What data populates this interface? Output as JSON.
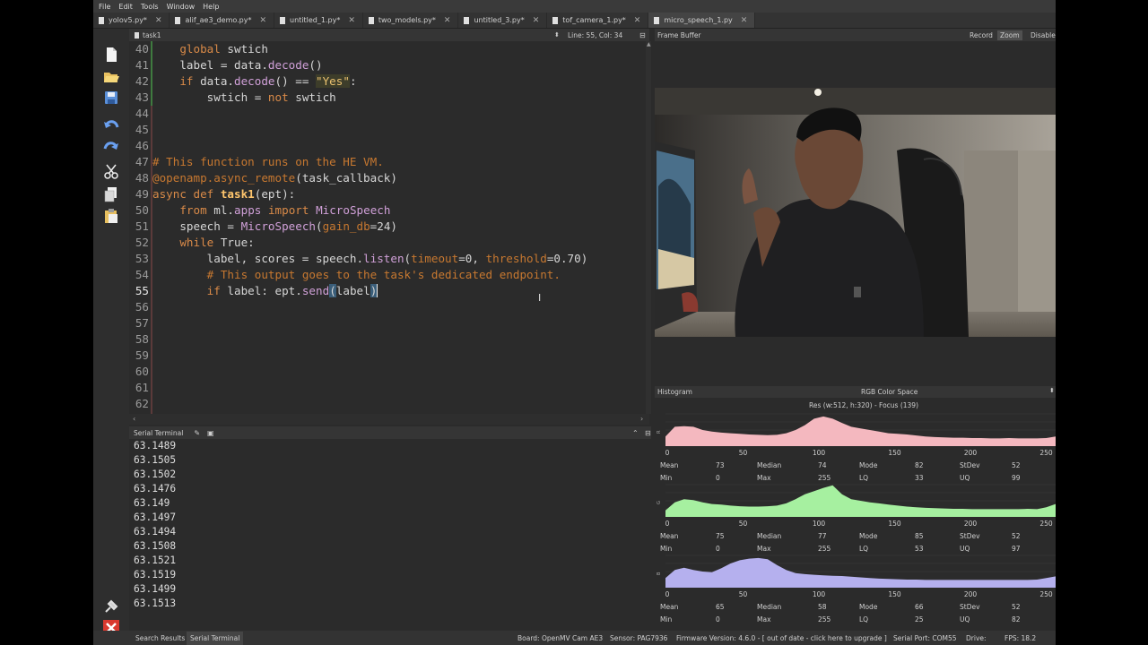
{
  "menu": [
    "File",
    "Edit",
    "Tools",
    "Window",
    "Help"
  ],
  "tabs": [
    {
      "label": "yolov5.py*"
    },
    {
      "label": "alif_ae3_demo.py*"
    },
    {
      "label": "untitled_1.py*"
    },
    {
      "label": "two_models.py*"
    },
    {
      "label": "untitled_3.py*"
    },
    {
      "label": "tof_camera_1.py*"
    },
    {
      "label": "micro_speech_1.py"
    }
  ],
  "editor": {
    "title": "task1",
    "position": "Line: 55, Col: 34",
    "line_numbers": [
      "40",
      "41",
      "42",
      "43",
      "44",
      "45",
      "46",
      "47",
      "48",
      "49",
      "50",
      "51",
      "52",
      "53",
      "54",
      "55",
      "56",
      "57",
      "58",
      "59",
      "60",
      "61",
      "62"
    ]
  },
  "frame_buffer": {
    "title": "Frame Buffer",
    "record": "Record",
    "zoom": "Zoom",
    "disable": "Disable"
  },
  "histogram": {
    "title": "Histogram",
    "colorspace": "RGB Color Space",
    "resolution": "Res (w:512, h:320) - Focus (139)",
    "ticks": [
      "0",
      "50",
      "100",
      "150",
      "200",
      "250"
    ],
    "labels": [
      "Mean",
      "Median",
      "Mode",
      "StDev",
      "Min",
      "Max",
      "LQ",
      "UQ"
    ],
    "channels": [
      {
        "name": "R",
        "color": "#f4b8bf",
        "mean": "73",
        "median": "74",
        "mode": "82",
        "stdev": "52",
        "min": "0",
        "max": "255",
        "lq": "33",
        "uq": "99"
      },
      {
        "name": "G",
        "color": "#a6f0a0",
        "mean": "75",
        "median": "77",
        "mode": "85",
        "stdev": "52",
        "min": "0",
        "max": "255",
        "lq": "53",
        "uq": "97"
      },
      {
        "name": "B",
        "color": "#b5b0ee",
        "mean": "65",
        "median": "58",
        "mode": "66",
        "stdev": "52",
        "min": "0",
        "max": "255",
        "lq": "25",
        "uq": "82"
      }
    ]
  },
  "serial": {
    "title": "Serial Terminal",
    "lines": [
      "63.1489",
      "63.1505",
      "63.1502",
      "63.1476",
      "63.149",
      "63.1497",
      "63.1494",
      "63.1508",
      "63.1521",
      "63.1519",
      "63.1499",
      "63.1513"
    ]
  },
  "statusbar": {
    "search_results": "Search Results",
    "serial_terminal": "Serial Terminal",
    "board": "Board: OpenMV Cam AE3",
    "sensor": "Sensor: PAG7936",
    "firmware": "Firmware Version: 4.6.0 - [ out of date - click here to upgrade ]",
    "serial_port": "Serial Port: COM55",
    "drive": "Drive:",
    "fps": "FPS: 18.2"
  }
}
